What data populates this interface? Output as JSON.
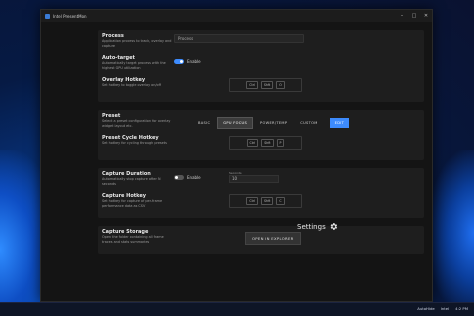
{
  "window": {
    "title": "Intel PresentMon"
  },
  "process": {
    "title": "Process",
    "desc": "Application process to track, overlay and capture",
    "value": "Process"
  },
  "auto_target": {
    "title": "Auto-target",
    "desc": "Automatically target process with the highest GPU utilization",
    "toggle_label": "Enable"
  },
  "overlay_hotkey": {
    "title": "Overlay Hotkey",
    "desc": "Set hotkey to toggle overlay on/off",
    "keys": [
      "Ctrl",
      "Shft",
      "O"
    ]
  },
  "preset": {
    "title": "Preset",
    "desc": "Select a preset configuration for overlay widget layout etc.",
    "options": [
      "BASIC",
      "GPU FOCUS",
      "POWER/TEMP",
      "CUSTOM"
    ],
    "selected": "GPU FOCUS",
    "edit_label": "EDIT"
  },
  "preset_cycle_hotkey": {
    "title": "Preset Cycle Hotkey",
    "desc": "Set hotkey for cycling through presets",
    "keys": [
      "Ctrl",
      "Shft",
      "P"
    ]
  },
  "capture_duration": {
    "title": "Capture Duration",
    "desc": "Automatically stop capture after N seconds",
    "toggle_label": "Enable",
    "field_label": "Seconds",
    "field_value": "10"
  },
  "capture_hotkey": {
    "title": "Capture Hotkey",
    "desc": "Set hotkey for capture of per-frame performance data as CSV",
    "keys": [
      "Ctrl",
      "Shft",
      "C"
    ]
  },
  "capture_storage": {
    "title": "Capture Storage",
    "desc": "Open the folder containing all frame traces and stats summaries",
    "button_label": "OPEN IN EXPLORER"
  },
  "settings_link": {
    "label": "Settings",
    "icon": "gear-icon"
  },
  "taskbar": {
    "tray": [
      "AutoHide",
      "Intel",
      "4:2 PM"
    ]
  }
}
